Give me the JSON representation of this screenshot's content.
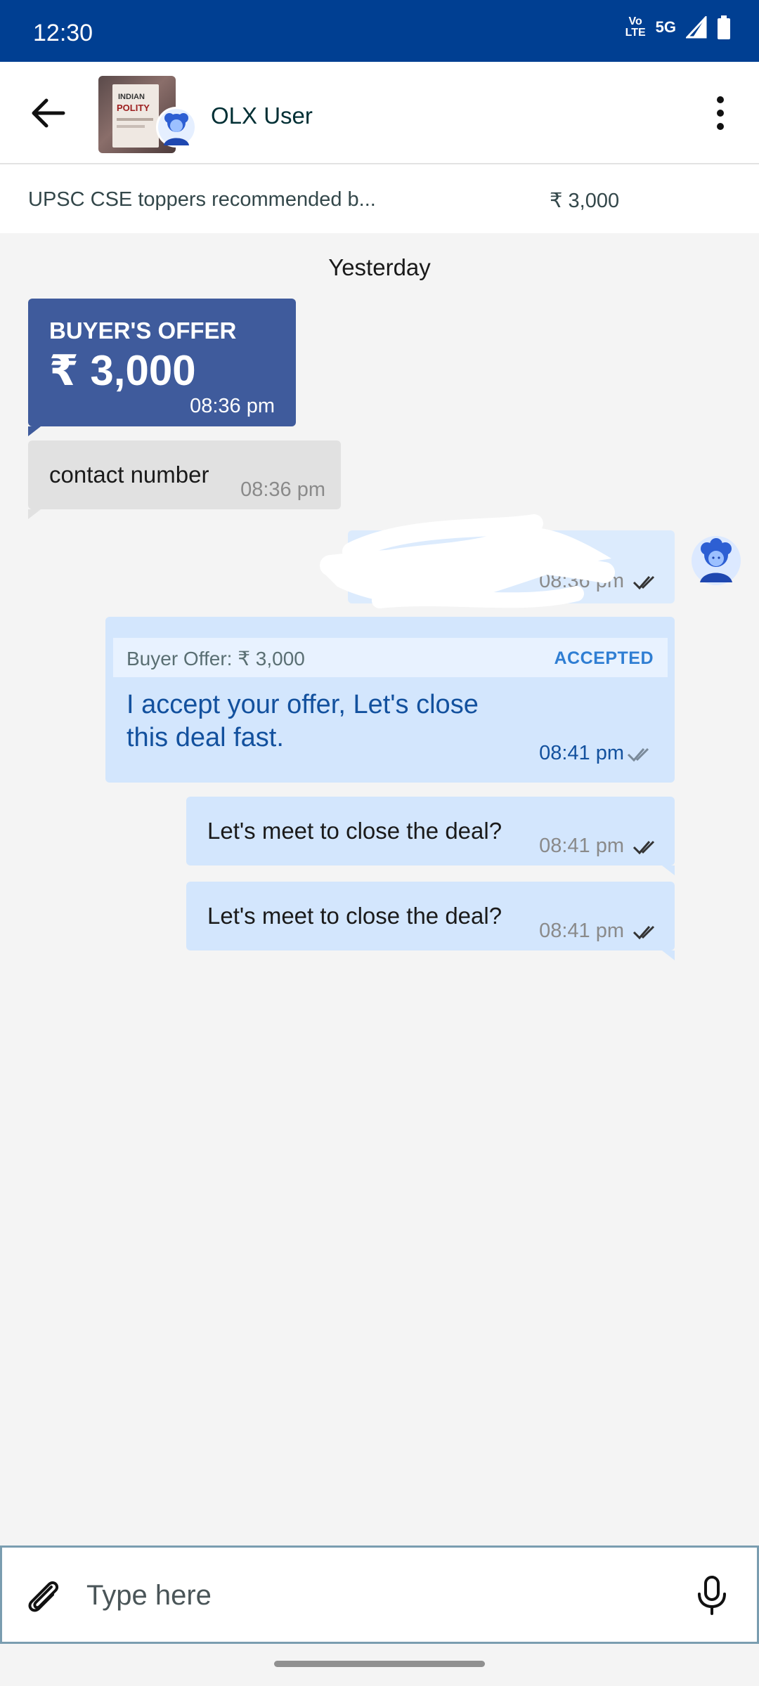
{
  "status_bar": {
    "time": "12:30",
    "volte_top": "Vo",
    "volte_bottom": "LTE",
    "network": "5G"
  },
  "header": {
    "back_icon": "arrow-left-icon",
    "user_name": "OLX User",
    "more_icon": "more-vertical-icon",
    "thumb_text_1": "INDIAN",
    "thumb_text_2": "POLITY"
  },
  "ad": {
    "title": "UPSC CSE toppers recommended b...",
    "price": "₹ 3,000"
  },
  "chat": {
    "day_separator": "Yesterday",
    "offer": {
      "label": "BUYER'S OFFER",
      "amount": "₹ 3,000",
      "time": "08:36 pm",
      "color": "#3f5b9c"
    },
    "contact": {
      "text": "contact number",
      "time": "08:36 pm"
    },
    "redacted": {
      "time": "08:36 pm"
    },
    "accepted": {
      "header": "Buyer Offer: ₹ 3,000",
      "status": "ACCEPTED",
      "message": "I accept your offer, Let's close this deal fast.",
      "time": "08:41 pm"
    },
    "messages": [
      {
        "text": "Let's meet to close the deal?",
        "time": "08:41 pm"
      },
      {
        "text": "Let's meet to close the deal?",
        "time": "08:41 pm"
      }
    ]
  },
  "composer": {
    "placeholder": "Type here",
    "attach_icon": "paperclip-icon",
    "mic_icon": "microphone-icon"
  },
  "colors": {
    "status_bar": "#003f92",
    "sent_bubble": "#d3e6fd",
    "received_bubble": "#e1e1e1",
    "accepted_label": "#2f7ed3"
  }
}
